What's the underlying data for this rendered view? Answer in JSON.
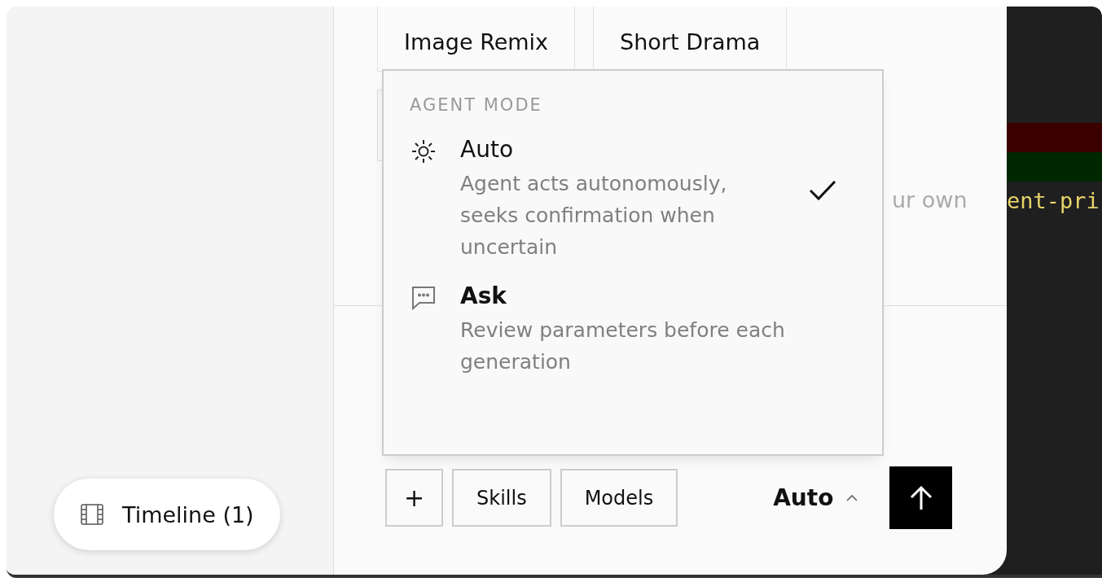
{
  "sidebar": {
    "timeline_button": {
      "label": "Timeline (1)"
    }
  },
  "templates": [
    {
      "label": "Image Remix"
    },
    {
      "label": "Short Drama"
    }
  ],
  "hint_fragment": "ur own",
  "mode_menu": {
    "heading": "AGENT MODE",
    "options": [
      {
        "kind": "auto",
        "title": "Auto",
        "description": "Agent acts autonomously, seeks confirmation when uncertain",
        "selected": true
      },
      {
        "kind": "ask",
        "title": "Ask",
        "description": "Review parameters before each generation",
        "selected": false
      }
    ]
  },
  "composer": {
    "buttons": [
      {
        "kind": "add",
        "label": "+"
      },
      {
        "kind": "text",
        "label": "Skills"
      },
      {
        "kind": "text",
        "label": "Models"
      }
    ],
    "mode": "Auto"
  },
  "code_panel": {
    "text": "ent-pri"
  }
}
